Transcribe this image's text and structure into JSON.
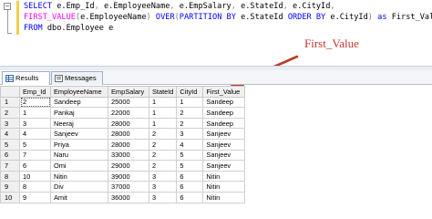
{
  "editor": {
    "lines": [
      {
        "parts": [
          [
            "kw",
            "SELECT "
          ],
          [
            "txt",
            "e.Emp_Id"
          ],
          [
            "op",
            ", "
          ],
          [
            "txt",
            "e.EmployeeName"
          ],
          [
            "op",
            ", "
          ],
          [
            "txt",
            "e.EmpSalary"
          ],
          [
            "op",
            ", "
          ],
          [
            "txt",
            "e.StateId"
          ],
          [
            "op",
            ", "
          ],
          [
            "txt",
            "e.CityId"
          ],
          [
            "op",
            ","
          ]
        ]
      },
      {
        "parts": [
          [
            "fn",
            "FIRST_VALUE"
          ],
          [
            "op",
            "("
          ],
          [
            "txt",
            "e.EmployeeName"
          ],
          [
            "op",
            ") "
          ],
          [
            "kw",
            "OVER"
          ],
          [
            "op",
            "("
          ],
          [
            "kw",
            "PARTITION BY "
          ],
          [
            "txt",
            "e.StateId "
          ],
          [
            "kw",
            "ORDER BY "
          ],
          [
            "txt",
            "e.CityId"
          ],
          [
            "op",
            ") "
          ],
          [
            "kw",
            "as "
          ],
          [
            "txt",
            "First_Value"
          ]
        ]
      },
      {
        "parts": [
          [
            "kw",
            "FROM "
          ],
          [
            "txt",
            "dbo.Employee e"
          ]
        ]
      }
    ]
  },
  "annotation": {
    "label": "First_Value",
    "color": "#c0392b"
  },
  "tabs": [
    {
      "label": "Results",
      "icon": "grid-icon",
      "active": true
    },
    {
      "label": "Messages",
      "icon": "messages-icon",
      "active": false
    }
  ],
  "results": {
    "columns": [
      "Emp_Id",
      "EmployeeName",
      "EmpSalary",
      "StateId",
      "CityId",
      "First_Value"
    ],
    "rows": [
      [
        "1",
        "2",
        "Sandeep",
        "25000",
        "1",
        "1",
        "Sandeep"
      ],
      [
        "2",
        "1",
        "Pankaj",
        "22000",
        "1",
        "2",
        "Sandeep"
      ],
      [
        "3",
        "3",
        "Neeraj",
        "28000",
        "1",
        "2",
        "Sandeep"
      ],
      [
        "4",
        "4",
        "Sanjeev",
        "28000",
        "2",
        "3",
        "Sanjeev"
      ],
      [
        "5",
        "5",
        "Priya",
        "28000",
        "2",
        "4",
        "Sanjeev"
      ],
      [
        "6",
        "7",
        "Naru",
        "33000",
        "2",
        "5",
        "Sanjeev"
      ],
      [
        "7",
        "6",
        "Omi",
        "29000",
        "2",
        "5",
        "Sanjeev"
      ],
      [
        "8",
        "10",
        "Nitin",
        "39000",
        "3",
        "6",
        "Nitin"
      ],
      [
        "9",
        "8",
        "Div",
        "37000",
        "3",
        "6",
        "Nitin"
      ],
      [
        "10",
        "9",
        "Amit",
        "36000",
        "3",
        "6",
        "Nitin"
      ]
    ]
  },
  "colors": {
    "keyword": "#0000ff",
    "function": "#ff00ff",
    "operator": "#808080",
    "arrow": "#c0392b"
  }
}
